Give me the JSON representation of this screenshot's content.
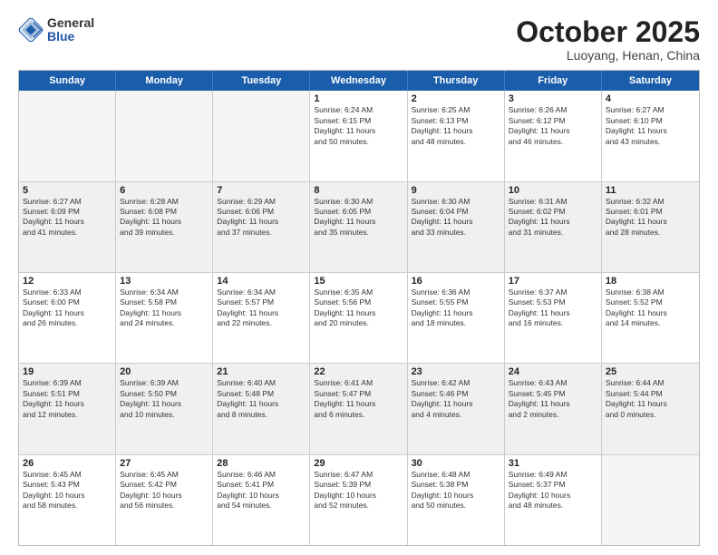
{
  "header": {
    "logo_general": "General",
    "logo_blue": "Blue",
    "month_title": "October 2025",
    "subtitle": "Luoyang, Henan, China"
  },
  "days_of_week": [
    "Sunday",
    "Monday",
    "Tuesday",
    "Wednesday",
    "Thursday",
    "Friday",
    "Saturday"
  ],
  "rows": [
    [
      {
        "day": "",
        "lines": []
      },
      {
        "day": "",
        "lines": []
      },
      {
        "day": "",
        "lines": []
      },
      {
        "day": "1",
        "lines": [
          "Sunrise: 6:24 AM",
          "Sunset: 6:15 PM",
          "Daylight: 11 hours",
          "and 50 minutes."
        ]
      },
      {
        "day": "2",
        "lines": [
          "Sunrise: 6:25 AM",
          "Sunset: 6:13 PM",
          "Daylight: 11 hours",
          "and 48 minutes."
        ]
      },
      {
        "day": "3",
        "lines": [
          "Sunrise: 6:26 AM",
          "Sunset: 6:12 PM",
          "Daylight: 11 hours",
          "and 46 minutes."
        ]
      },
      {
        "day": "4",
        "lines": [
          "Sunrise: 6:27 AM",
          "Sunset: 6:10 PM",
          "Daylight: 11 hours",
          "and 43 minutes."
        ]
      }
    ],
    [
      {
        "day": "5",
        "lines": [
          "Sunrise: 6:27 AM",
          "Sunset: 6:09 PM",
          "Daylight: 11 hours",
          "and 41 minutes."
        ]
      },
      {
        "day": "6",
        "lines": [
          "Sunrise: 6:28 AM",
          "Sunset: 6:08 PM",
          "Daylight: 11 hours",
          "and 39 minutes."
        ]
      },
      {
        "day": "7",
        "lines": [
          "Sunrise: 6:29 AM",
          "Sunset: 6:06 PM",
          "Daylight: 11 hours",
          "and 37 minutes."
        ]
      },
      {
        "day": "8",
        "lines": [
          "Sunrise: 6:30 AM",
          "Sunset: 6:05 PM",
          "Daylight: 11 hours",
          "and 35 minutes."
        ]
      },
      {
        "day": "9",
        "lines": [
          "Sunrise: 6:30 AM",
          "Sunset: 6:04 PM",
          "Daylight: 11 hours",
          "and 33 minutes."
        ]
      },
      {
        "day": "10",
        "lines": [
          "Sunrise: 6:31 AM",
          "Sunset: 6:02 PM",
          "Daylight: 11 hours",
          "and 31 minutes."
        ]
      },
      {
        "day": "11",
        "lines": [
          "Sunrise: 6:32 AM",
          "Sunset: 6:01 PM",
          "Daylight: 11 hours",
          "and 28 minutes."
        ]
      }
    ],
    [
      {
        "day": "12",
        "lines": [
          "Sunrise: 6:33 AM",
          "Sunset: 6:00 PM",
          "Daylight: 11 hours",
          "and 26 minutes."
        ]
      },
      {
        "day": "13",
        "lines": [
          "Sunrise: 6:34 AM",
          "Sunset: 5:58 PM",
          "Daylight: 11 hours",
          "and 24 minutes."
        ]
      },
      {
        "day": "14",
        "lines": [
          "Sunrise: 6:34 AM",
          "Sunset: 5:57 PM",
          "Daylight: 11 hours",
          "and 22 minutes."
        ]
      },
      {
        "day": "15",
        "lines": [
          "Sunrise: 6:35 AM",
          "Sunset: 5:56 PM",
          "Daylight: 11 hours",
          "and 20 minutes."
        ]
      },
      {
        "day": "16",
        "lines": [
          "Sunrise: 6:36 AM",
          "Sunset: 5:55 PM",
          "Daylight: 11 hours",
          "and 18 minutes."
        ]
      },
      {
        "day": "17",
        "lines": [
          "Sunrise: 6:37 AM",
          "Sunset: 5:53 PM",
          "Daylight: 11 hours",
          "and 16 minutes."
        ]
      },
      {
        "day": "18",
        "lines": [
          "Sunrise: 6:38 AM",
          "Sunset: 5:52 PM",
          "Daylight: 11 hours",
          "and 14 minutes."
        ]
      }
    ],
    [
      {
        "day": "19",
        "lines": [
          "Sunrise: 6:39 AM",
          "Sunset: 5:51 PM",
          "Daylight: 11 hours",
          "and 12 minutes."
        ]
      },
      {
        "day": "20",
        "lines": [
          "Sunrise: 6:39 AM",
          "Sunset: 5:50 PM",
          "Daylight: 11 hours",
          "and 10 minutes."
        ]
      },
      {
        "day": "21",
        "lines": [
          "Sunrise: 6:40 AM",
          "Sunset: 5:48 PM",
          "Daylight: 11 hours",
          "and 8 minutes."
        ]
      },
      {
        "day": "22",
        "lines": [
          "Sunrise: 6:41 AM",
          "Sunset: 5:47 PM",
          "Daylight: 11 hours",
          "and 6 minutes."
        ]
      },
      {
        "day": "23",
        "lines": [
          "Sunrise: 6:42 AM",
          "Sunset: 5:46 PM",
          "Daylight: 11 hours",
          "and 4 minutes."
        ]
      },
      {
        "day": "24",
        "lines": [
          "Sunrise: 6:43 AM",
          "Sunset: 5:45 PM",
          "Daylight: 11 hours",
          "and 2 minutes."
        ]
      },
      {
        "day": "25",
        "lines": [
          "Sunrise: 6:44 AM",
          "Sunset: 5:44 PM",
          "Daylight: 11 hours",
          "and 0 minutes."
        ]
      }
    ],
    [
      {
        "day": "26",
        "lines": [
          "Sunrise: 6:45 AM",
          "Sunset: 5:43 PM",
          "Daylight: 10 hours",
          "and 58 minutes."
        ]
      },
      {
        "day": "27",
        "lines": [
          "Sunrise: 6:45 AM",
          "Sunset: 5:42 PM",
          "Daylight: 10 hours",
          "and 56 minutes."
        ]
      },
      {
        "day": "28",
        "lines": [
          "Sunrise: 6:46 AM",
          "Sunset: 5:41 PM",
          "Daylight: 10 hours",
          "and 54 minutes."
        ]
      },
      {
        "day": "29",
        "lines": [
          "Sunrise: 6:47 AM",
          "Sunset: 5:39 PM",
          "Daylight: 10 hours",
          "and 52 minutes."
        ]
      },
      {
        "day": "30",
        "lines": [
          "Sunrise: 6:48 AM",
          "Sunset: 5:38 PM",
          "Daylight: 10 hours",
          "and 50 minutes."
        ]
      },
      {
        "day": "31",
        "lines": [
          "Sunrise: 6:49 AM",
          "Sunset: 5:37 PM",
          "Daylight: 10 hours",
          "and 48 minutes."
        ]
      },
      {
        "day": "",
        "lines": []
      }
    ]
  ]
}
